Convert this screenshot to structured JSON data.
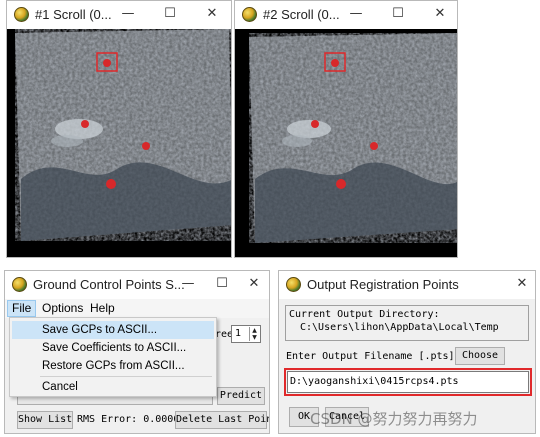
{
  "scroll_window_1": {
    "title": "#1 Scroll (0...",
    "minimize": "—",
    "maximize": "☐",
    "close": "✕"
  },
  "scroll_window_2": {
    "title": "#2 Scroll (0...",
    "minimize": "—",
    "maximize": "☐",
    "close": "✕"
  },
  "gcp_window": {
    "title": "Ground Control Points S...",
    "minimize": "—",
    "maximize": "☐",
    "close": "✕",
    "menu": [
      "File",
      "Options",
      "Help"
    ],
    "file_menu": [
      "Save GCPs to ASCII...",
      "Save Coefficients to ASCII...",
      "Restore GCPs from ASCII...",
      "Cancel"
    ],
    "degree_label": "ree",
    "degree_value": "1",
    "predict_button": "Predict",
    "show_list_button": "Show List",
    "rms_error": "RMS Error: 0.000000",
    "delete_last_point_button": "Delete Last Point"
  },
  "output_window": {
    "title": "Output Registration Points",
    "close": "✕",
    "current_dir_label": "Current Output Directory:",
    "current_dir_value": "C:\\Users\\lihon\\AppData\\Local\\Temp",
    "filename_label": "Enter Output Filename [.pts]",
    "choose_button": "Choose",
    "filename_value": "D:\\yaoganshixi\\0415rcps4.pts",
    "ok_button": "OK",
    "cancel_button": "Cancel"
  },
  "watermark": "CSDN @努力努力再努力",
  "colors": {
    "highlight_box": "#e0292b",
    "menu_highlight": "#cce4f7"
  }
}
